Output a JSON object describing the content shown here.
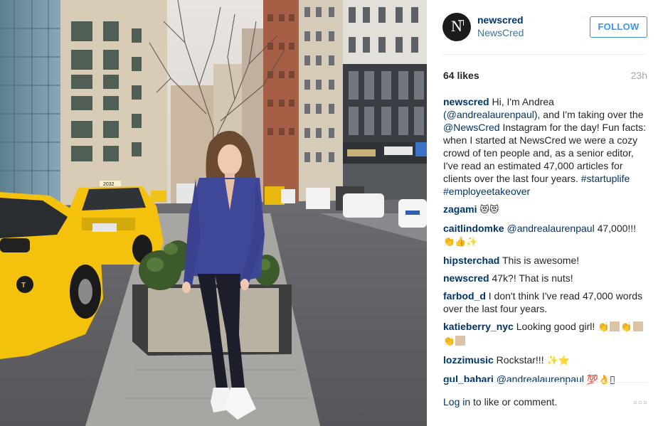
{
  "post": {
    "username": "newscred",
    "full_name": "NewsCred",
    "follow_label": "FOLLOW",
    "likes": "64 likes",
    "age": "23h",
    "photo_taxi_sign": "2032"
  },
  "comments": [
    {
      "user": "newscred",
      "parts": [
        {
          "t": " Hi, I'm Andrea ",
          "c": "text"
        },
        {
          "t": "(@andrealaurenpaul)",
          "c": "link"
        },
        {
          "t": ", and I'm taking over the ",
          "c": "text"
        },
        {
          "t": "@NewsCred",
          "c": "link"
        },
        {
          "t": " Instagram for the day! Fun facts: when I started at NewsCred we were a cozy crowd of ten people and, as a senior editor, I've read an estimated 47,000 articles for clients over the last four years. ",
          "c": "text"
        },
        {
          "t": "#startuplife",
          "c": "link"
        },
        {
          "t": " ",
          "c": "text"
        },
        {
          "t": "#employeetakeover",
          "c": "link"
        }
      ]
    },
    {
      "user": "zagami",
      "parts": [
        {
          "t": " ",
          "c": "text"
        },
        {
          "t": "😻😻",
          "c": "emoji"
        }
      ]
    },
    {
      "user": "caitlindomke",
      "parts": [
        {
          "t": " ",
          "c": "text"
        },
        {
          "t": "@andrealaurenpaul",
          "c": "link"
        },
        {
          "t": " 47,000!!! ",
          "c": "text"
        },
        {
          "t": "👏👍✨",
          "c": "emoji"
        }
      ]
    },
    {
      "user": "hipsterchad",
      "parts": [
        {
          "t": " This is awesome!",
          "c": "text"
        }
      ]
    },
    {
      "user": "newscred",
      "parts": [
        {
          "t": " 47k?! That is nuts!",
          "c": "text"
        }
      ]
    },
    {
      "user": "farbod_d",
      "parts": [
        {
          "t": " I don't think I've read 47,000 words over the last four years.",
          "c": "text"
        }
      ]
    },
    {
      "user": "katieberry_nyc",
      "parts": [
        {
          "t": " Looking good girl! ",
          "c": "text"
        },
        {
          "t": "👏",
          "c": "emoji"
        },
        {
          "t": "",
          "c": "skin"
        },
        {
          "t": "👏",
          "c": "emoji"
        },
        {
          "t": "",
          "c": "skin"
        },
        {
          "t": "👏",
          "c": "emoji"
        },
        {
          "t": "",
          "c": "skin"
        }
      ]
    },
    {
      "user": "lozzimusic",
      "parts": [
        {
          "t": " Rockstar!!! ",
          "c": "text"
        },
        {
          "t": "✨⭐",
          "c": "emoji"
        }
      ]
    },
    {
      "user": "gul_bahari",
      "parts": [
        {
          "t": " ",
          "c": "text"
        },
        {
          "t": "@andrealaurenpaul",
          "c": "link"
        },
        {
          "t": " ",
          "c": "text"
        },
        {
          "t": "💯👌",
          "c": "emoji"
        },
        {
          "t": "▯",
          "c": "text"
        }
      ]
    }
  ],
  "footer": {
    "login_label": "Log in",
    "login_suffix": " to like or comment.",
    "more_label": "○○○"
  },
  "colors": {
    "link": "#003569",
    "follow": "#3897f0",
    "muted": "#a5a7aa",
    "taxi": "#f4c20d"
  },
  "icons": {
    "avatar": "newscred-logo-icon",
    "more": "more-options-icon"
  }
}
